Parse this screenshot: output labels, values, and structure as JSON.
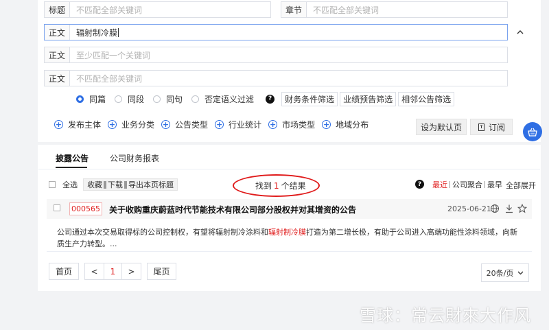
{
  "search": {
    "title_label": "标题",
    "title_placeholder": "不匹配全部关键词",
    "chapter_label": "章节",
    "chapter_placeholder": "不匹配全部关键词",
    "body1_label": "正文",
    "body1_value": "辐射制冷膜",
    "body2_label": "正文",
    "body2_placeholder": "至少匹配一个关键词",
    "body3_label": "正文",
    "body3_placeholder": "不匹配全部关键词"
  },
  "scope": {
    "options": [
      "同篇",
      "同段",
      "同句",
      "否定语义过滤"
    ],
    "selected": "同篇"
  },
  "filters": [
    "财务条件筛选",
    "业绩预告筛选",
    "相邻公告筛选"
  ],
  "categories": [
    "发布主体",
    "业务分类",
    "公告类型",
    "行业统计",
    "市场类型",
    "地域分布"
  ],
  "actions": {
    "set_default": "设为默认页",
    "subscribe": "订阅"
  },
  "tabs": [
    "披露公告",
    "公司财务报表"
  ],
  "toolbar": {
    "select_all": "全选",
    "collect": "收藏",
    "download": "下载",
    "export": "导出本页标题"
  },
  "results_summary": {
    "prefix": "找到",
    "count": "1",
    "suffix": "个结果"
  },
  "sort": {
    "latest": "最近",
    "aggregate": "公司聚合",
    "earliest": "最早",
    "expand_all": "全部展开"
  },
  "result": {
    "code": "000565",
    "title": "关于收购重庆蔚蓝时代节能技术有限公司部分股权并对其增资的公告",
    "date": "2025-06-21",
    "snippet_before": "公司通过本次交易取得标的公司控制权，有望将辐射制冷涂料和",
    "snippet_highlight": "辐射制冷膜",
    "snippet_after": "打造为第二增长极，有助于公司进入高端功能性涂料领域，向新质生产力转型。..."
  },
  "pagination": {
    "first": "首页",
    "prev": "<",
    "current": "1",
    "next": ">",
    "last": "尾页",
    "per_page": "20条/页"
  },
  "watermark": "雪球：常云財來大作风",
  "colors": {
    "accent": "#2f6fe4",
    "highlight": "#e02020"
  }
}
